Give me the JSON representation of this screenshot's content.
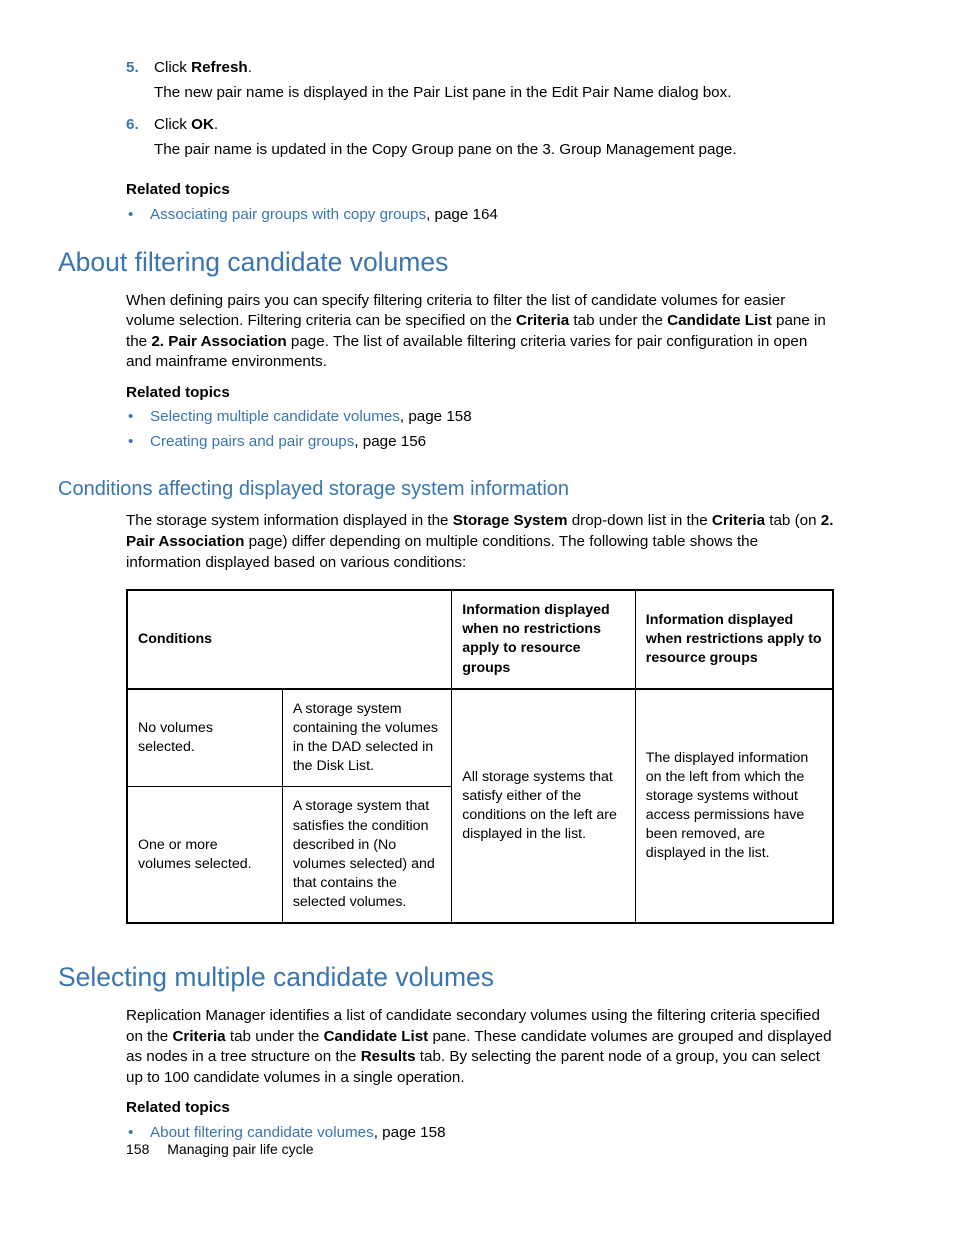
{
  "steps": {
    "s5": {
      "num": "5.",
      "lead": "Click ",
      "bold": "Refresh",
      "tail": ".",
      "sub": "The new pair name is displayed in the Pair List pane in the Edit Pair Name dialog box."
    },
    "s6": {
      "num": "6.",
      "lead": "Click ",
      "bold": "OK",
      "tail": ".",
      "sub": "The pair name is updated in the Copy Group pane on the 3. Group Management page."
    }
  },
  "rt_label": "Related topics",
  "rt1": {
    "link": "Associating pair groups with copy groups",
    "tail": ", page 164"
  },
  "h_about": "About filtering candidate volumes",
  "about_p": {
    "a": "When defining pairs you can specify filtering criteria to filter the list of candidate volumes for easier volume selection. Filtering criteria can be specified on the ",
    "b": "Criteria",
    "c": " tab under the ",
    "d": "Candidate List",
    "e": " pane in the ",
    "f": "2. Pair Association",
    "g": " page. The list of available filtering criteria varies for pair configuration in open and mainframe environments."
  },
  "rt2a": {
    "link": "Selecting multiple candidate volumes",
    "tail": ", page 158"
  },
  "rt2b": {
    "link": "Creating pairs and pair groups",
    "tail": ", page 156"
  },
  "h_cond": "Conditions affecting displayed storage system information",
  "cond_p": {
    "a": "The storage system information displayed in the ",
    "b": "Storage System",
    "c": " drop-down list in the ",
    "d": "Criteria",
    "e": " tab (on ",
    "f": "2. Pair Association",
    "g": " page) differ depending on multiple conditions. The following table shows the information displayed based on various conditions:"
  },
  "table": {
    "th1": "Conditions",
    "th2": "Information displayed when no restrictions apply to resource groups",
    "th3": "Information displayed when restrictions apply to resource groups",
    "r1c1": "No volumes selected.",
    "r1c2": "A storage system containing the volumes in the DAD selected in the Disk List.",
    "r2c1": "One or more volumes selected.",
    "r2c2": "A storage system that satisfies the condition described in (No volumes selected) and that contains the selected volumes.",
    "mergedA": "All storage systems that satisfy either of the conditions on the left are displayed in the list.",
    "mergedB": "The displayed information on the left from which the storage systems without access permissions have been removed, are displayed in the list."
  },
  "h_select": "Selecting multiple candidate volumes",
  "select_p": {
    "a": "Replication Manager identifies a list of candidate secondary volumes using the filtering criteria specified on the ",
    "b": "Criteria",
    "c": " tab under the ",
    "d": "Candidate List",
    "e": " pane. These candidate volumes are grouped and displayed as nodes in a tree structure on the ",
    "f": "Results",
    "g": " tab.  By selecting the parent node of a group, you can select up to 100 candidate volumes in a single operation."
  },
  "rt3": {
    "link": "About filtering candidate volumes",
    "tail": ", page 158"
  },
  "footer": {
    "page": "158",
    "title": "Managing pair life cycle"
  }
}
